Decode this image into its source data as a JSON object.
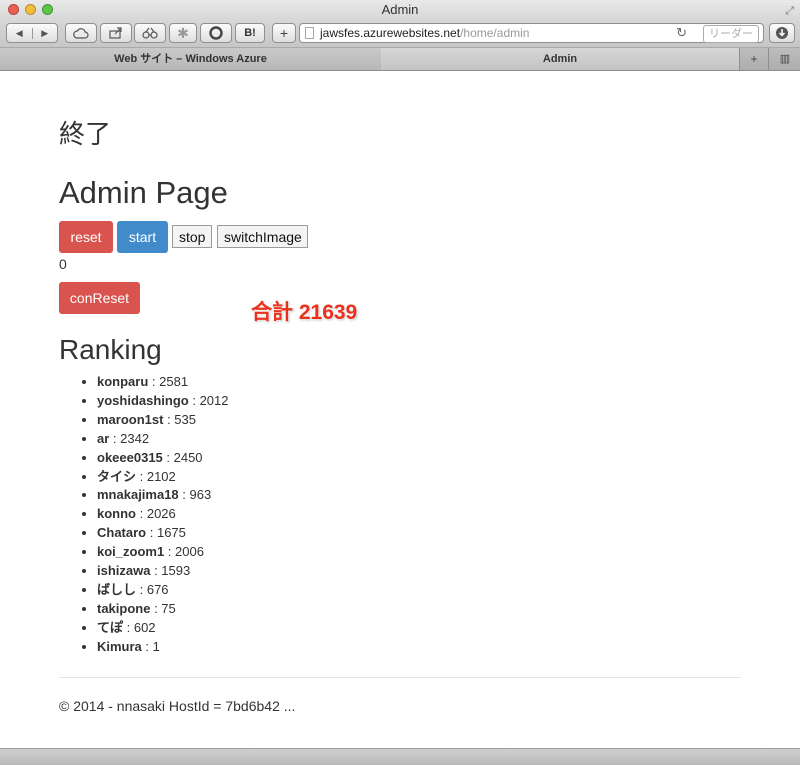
{
  "window": {
    "title": "Admin"
  },
  "toolbar": {
    "back_icon": "◀",
    "forward_icon": "▶",
    "bookmarks_b_label": "B!",
    "add_label": "+",
    "url_host": "jawsfes.azurewebsites.net",
    "url_path": "/home/admin",
    "reload_icon": "↻",
    "reader_label": "リーダー"
  },
  "tabs": [
    {
      "label": "Web サイト – Windows Azure"
    },
    {
      "label": "Admin"
    }
  ],
  "tab_add_label": "+",
  "page": {
    "end_text": "終了",
    "title": "Admin Page",
    "buttons": {
      "reset": "reset",
      "start": "start",
      "stop": "stop",
      "switch_image": "switchImage",
      "con_reset": "conReset"
    },
    "counter": "0",
    "total": "合計 21639",
    "ranking_title": "Ranking",
    "ranking": [
      {
        "name": "konparu",
        "score": " : 2581"
      },
      {
        "name": "yoshidashingo",
        "score": " : 2012"
      },
      {
        "name": "maroon1st",
        "score": " : 535"
      },
      {
        "name": "ar",
        "score": " : 2342"
      },
      {
        "name": "okeee0315",
        "score": " : 2450"
      },
      {
        "name": "タイシ",
        "score": " : 2102"
      },
      {
        "name": "mnakajima18",
        "score": " : 963"
      },
      {
        "name": "konno",
        "score": " : 2026"
      },
      {
        "name": "Chataro",
        "score": " : 1675"
      },
      {
        "name": "koi_zoom1",
        "score": " : 2006"
      },
      {
        "name": "ishizawa",
        "score": " : 1593"
      },
      {
        "name": "ばしし",
        "score": " : 676"
      },
      {
        "name": "takipone",
        "score": " : 75"
      },
      {
        "name": "てぽ",
        "score": " : 602"
      },
      {
        "name": "Kimura",
        "score": " : 1"
      }
    ],
    "footer": "© 2014 - nnasaki HostId = 7bd6b42 ..."
  },
  "colors": {
    "danger": "#d9534f",
    "primary": "#428bca",
    "total_red": "#e8321e"
  }
}
